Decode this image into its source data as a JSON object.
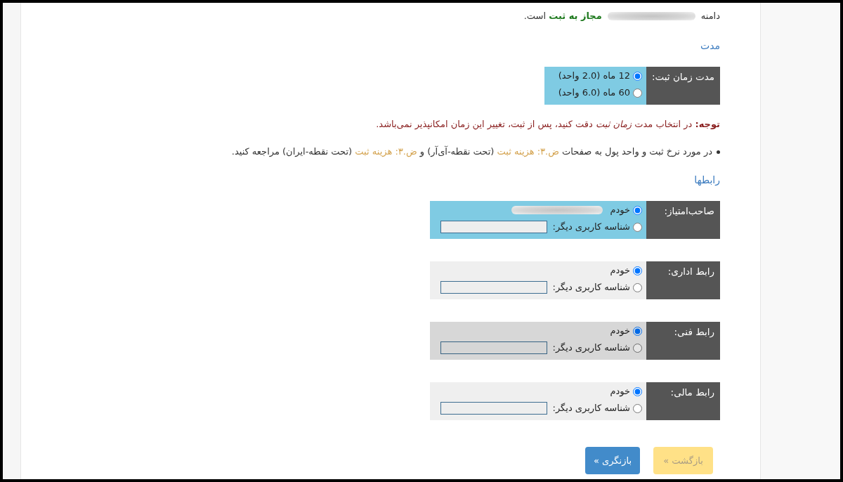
{
  "availability": {
    "prefix": "دامنه",
    "domain_blurred": true,
    "suffix": "**مجاز به ثبت** است."
  },
  "duration": {
    "heading": "مدت",
    "label": "مدت زمان ثبت:",
    "active": true,
    "options": [
      {
        "label": "12 ماه (2.0 واحد)",
        "selected": true
      },
      {
        "label": "60 ماه (6.0 واحد)",
        "selected": false
      }
    ]
  },
  "note": "**توجه:** در انتخاب مدت *زمان ثبت* دقت کنید، پس از ثبت، تغییر این زمان امکانپذیر نمی‌باشد.",
  "info": {
    "parts": [
      {
        "kind": "text",
        "text": "در مورد نرخ ثبت و واحد پول به صفحات "
      },
      {
        "kind": "link",
        "text": "ض.۳: هزینه ثبت"
      },
      {
        "kind": "text",
        "text": " (تحت نقطه-آی‌آر) و "
      },
      {
        "kind": "link",
        "text": "ض.۳: هزینه ثبت"
      },
      {
        "kind": "text",
        "text": " (تحت نقطه-ایران) مراجعه کنید."
      }
    ]
  },
  "contacts_section": {
    "heading": "رابطها",
    "contacts": [
      {
        "label": "صاحب‌امتیاز:",
        "active": true,
        "hovered": false,
        "options": [
          {
            "kind": "self",
            "label": "خودم",
            "selected": true,
            "name_blurred": true
          },
          {
            "kind": "other",
            "label": "شناسه کاربری دیگر:",
            "selected": false
          }
        ]
      },
      {
        "label": "رابط اداری:",
        "active": false,
        "hovered": false,
        "options": [
          {
            "kind": "self",
            "label": "خودم",
            "selected": true,
            "name_blurred": false
          },
          {
            "kind": "other",
            "label": "شناسه کاربری دیگر:",
            "selected": false
          }
        ]
      },
      {
        "label": "رابط فنی:",
        "active": false,
        "hovered": true,
        "options": [
          {
            "kind": "self",
            "label": "خودم",
            "selected": true,
            "name_blurred": false
          },
          {
            "kind": "other",
            "label": "شناسه کاربری دیگر:",
            "selected": false
          }
        ]
      },
      {
        "label": "رابط مالی:",
        "active": false,
        "hovered": false,
        "options": [
          {
            "kind": "self",
            "label": "خودم",
            "selected": true,
            "name_blurred": false
          },
          {
            "kind": "other",
            "label": "شناسه کاربری دیگر:",
            "selected": false
          }
        ]
      }
    ]
  },
  "buttons": [
    {
      "kind": "back",
      "label": "بازگشت »",
      "disabled": true
    },
    {
      "kind": "review",
      "label": "بازنگری »",
      "disabled": false
    }
  ]
}
